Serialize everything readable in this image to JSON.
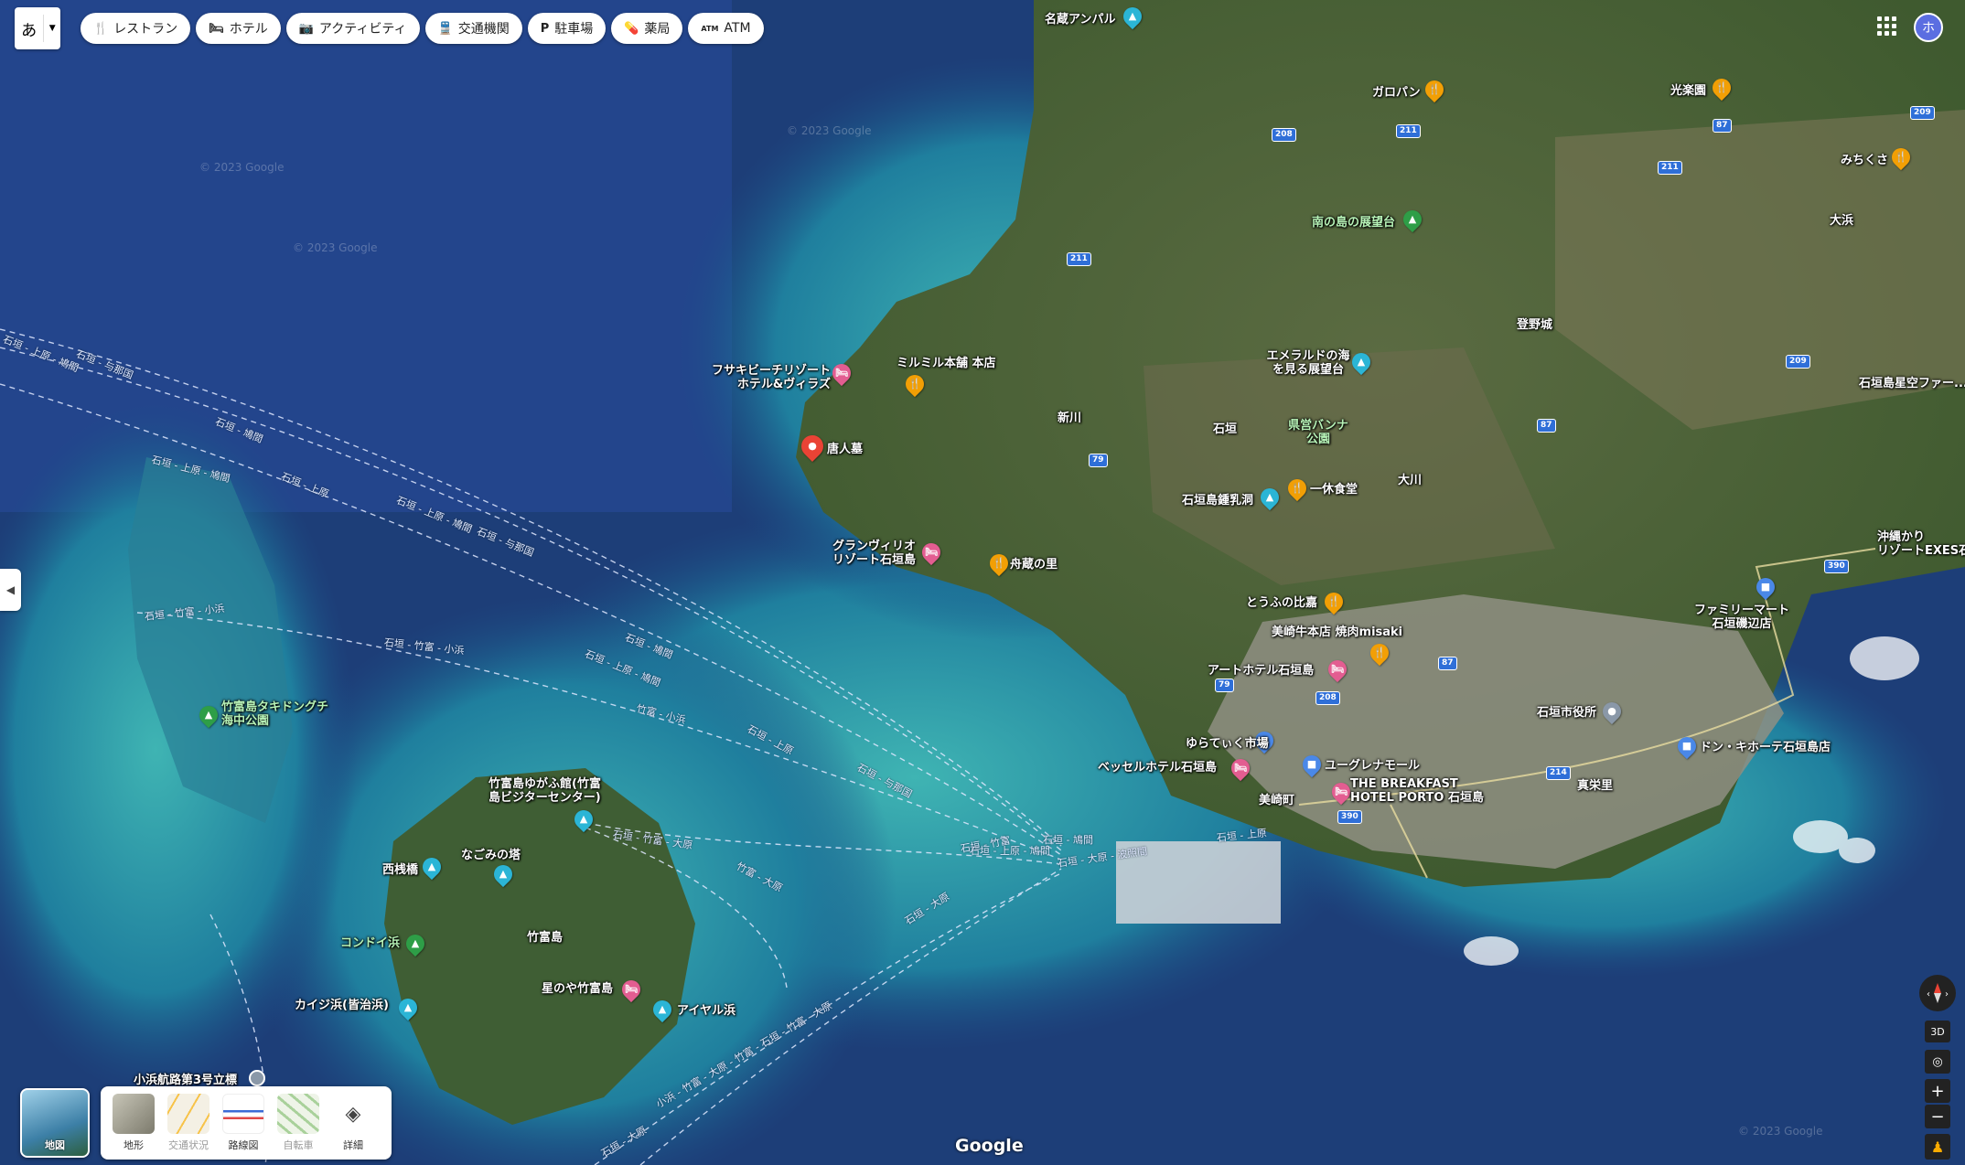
{
  "lang_button": {
    "label": "あ"
  },
  "categories": [
    {
      "icon": "restaurant-icon",
      "glyph": "🍴",
      "label": "レストラン"
    },
    {
      "icon": "hotel-icon",
      "glyph": "🛏",
      "label": "ホテル"
    },
    {
      "icon": "camera-icon",
      "glyph": "📷",
      "label": "アクティビティ"
    },
    {
      "icon": "transit-icon",
      "glyph": "🚆",
      "label": "交通機関"
    },
    {
      "icon": "parking-icon",
      "glyph": "P",
      "label": "駐車場"
    },
    {
      "icon": "pharmacy-icon",
      "glyph": "💊",
      "label": "薬局"
    },
    {
      "icon": "atm-icon",
      "glyph": "ATM",
      "label": "ATM"
    }
  ],
  "account": {
    "initial": "ホ"
  },
  "colors": {
    "restaurant": "#f29f05",
    "hotel": "#e35d91",
    "attraction": "#2bb5d6",
    "park": "#2e9e47",
    "selected": "#ea4335",
    "shop": "#4a88e8"
  },
  "places": {
    "nagura_amparu": "名蔵アンパル",
    "garopan": "ガロパン",
    "kourakuen": "光楽園",
    "michikusa": "みちくさ",
    "minaminoshima": "南の島の展望台",
    "noborono": "登野城",
    "oohama": "大浜",
    "fusaki": "フサキビーチリゾート\nホテル&ヴィラズ",
    "mirumiru": "ミルミル本舗 本店",
    "emerald": "エメラルドの海\nを見る展望台",
    "hoshizora": "石垣島星空ファー...",
    "toujinbaka": "唐人墓",
    "arakawa": "新川",
    "ishigaki_area": "石垣",
    "banna_park": "県営バンナ\n公園",
    "ookawa": "大川",
    "shonyudo": "石垣島鍾乳洞",
    "ikkyu": "一休食堂",
    "okinawa_kari": "沖縄かり\nリゾートEXES石",
    "grandvrio": "グランヴィリオ\nリゾート石垣島",
    "funakura": "舟蔵の里",
    "toufu": "とうふの比嘉",
    "familymart": "ファミリーマート\n石垣磯辺店",
    "misaki": "美崎牛本店 焼肉misaki",
    "art_hotel": "アートホテル石垣島",
    "city_hall": "石垣市役所",
    "taketomi_marine": "竹富島タキドングチ\n海中公園",
    "yugafu": "竹富島ゆがふ館(竹富\n島ビジターセンター)",
    "yuratiku": "ゆらてぃく市場",
    "besseru": "ベッセルホテル石垣島",
    "euglena": "ユーグレナモール",
    "breakfast": "THE BREAKFAST\nHOTEL PORTO 石垣島",
    "donki": "ドン・キホーテ石垣島店",
    "mizaki": "美崎町",
    "shinei": "真栄里",
    "nishisanbashi": "西桟橋",
    "nagomi": "なごみの塔",
    "taketomi": "竹富島",
    "kondoi": "コンドイ浜",
    "hoshinoya": "星のや竹富島",
    "kaiji": "カイジ浜(皆治浜)",
    "aiyaru": "アイヤル浜",
    "kohama_beacon": "小浜航路第3号立標"
  },
  "ferry_routes": {
    "r1": "石垣 - 鳩間",
    "r2": "石垣 - 上原",
    "r3": "石垣 - 与那国",
    "r4": "石垣 - 上原 - 鳩間",
    "r5": "石垣 - 竹富 - 小浜",
    "r6": "竹富 - 小浜",
    "r7": "石垣 - 竹富 - 大原",
    "r8": "竹富 - 大原",
    "r9": "石垣 - 大原",
    "r10": "石垣 - 竹富",
    "r11": "石垣 - 大原 - 波照間",
    "r12": "小浜 - 竹富 - 大原 - 竹富 - 石垣 - 竹富 - 大原",
    "r13": "石垣 - 大原"
  },
  "road_shields": [
    "211",
    "208",
    "211",
    "87",
    "211",
    "209",
    "209",
    "87",
    "79",
    "390",
    "87",
    "208",
    "79",
    "214",
    "390"
  ],
  "watermark": "© 2023 Google",
  "layers": {
    "current": "地図",
    "options": [
      {
        "icon": "terrain-icon",
        "label": "地形"
      },
      {
        "icon": "traffic-icon",
        "label": "交通状況"
      },
      {
        "icon": "transit-line-icon",
        "label": "路線図"
      },
      {
        "icon": "bicycle-icon",
        "label": "自転車"
      },
      {
        "icon": "layers-icon",
        "label": "詳細"
      }
    ]
  },
  "controls": {
    "tilt": "3D"
  },
  "brand": "Google"
}
